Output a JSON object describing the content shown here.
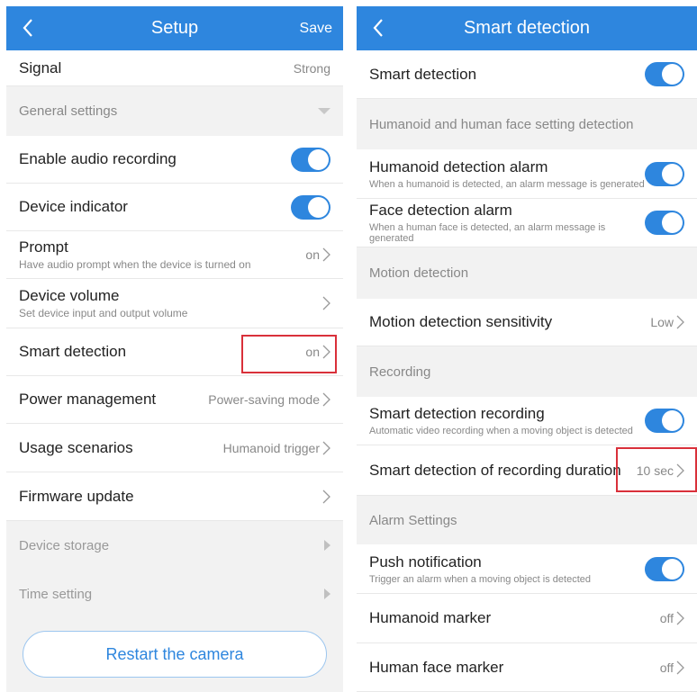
{
  "setup": {
    "title": "Setup",
    "save_label": "Save",
    "signal": {
      "label": "Signal",
      "value": "Strong"
    },
    "general_settings_header": "General settings",
    "enable_audio_recording": {
      "label": "Enable audio recording",
      "enabled": true
    },
    "device_indicator": {
      "label": "Device indicator",
      "enabled": true
    },
    "prompt": {
      "label": "Prompt",
      "desc": "Have audio prompt when the device is turned on",
      "value": "on"
    },
    "device_volume": {
      "label": "Device volume",
      "desc": "Set device input and output volume"
    },
    "smart_detection": {
      "label": "Smart detection",
      "value": "on"
    },
    "power_management": {
      "label": "Power management",
      "value": "Power-saving mode"
    },
    "usage_scenarios": {
      "label": "Usage scenarios",
      "value": "Humanoid trigger"
    },
    "firmware_update": {
      "label": "Firmware update"
    },
    "device_storage": {
      "label": "Device storage"
    },
    "time_setting": {
      "label": "Time setting"
    },
    "restart_label": "Restart the camera"
  },
  "smart": {
    "title": "Smart detection",
    "smart_detection": {
      "label": "Smart detection",
      "enabled": true
    },
    "humanoid_header": "Humanoid and human face setting detection",
    "humanoid_alarm": {
      "label": "Humanoid detection alarm",
      "desc": "When a humanoid is detected, an alarm message is generated",
      "enabled": true
    },
    "face_alarm": {
      "label": "Face detection alarm",
      "desc": "When a human face is detected, an alarm message is generated",
      "enabled": true
    },
    "motion_header": "Motion detection",
    "motion_sensitivity": {
      "label": "Motion detection sensitivity",
      "value": "Low"
    },
    "recording_header": "Recording",
    "smart_recording": {
      "label": "Smart detection recording",
      "desc": "Automatic video recording when a moving object is detected",
      "enabled": true
    },
    "recording_duration": {
      "label": "Smart detection of recording duration",
      "value": "10 sec"
    },
    "alarm_header": "Alarm Settings",
    "push_notification": {
      "label": "Push notification",
      "desc": "Trigger an alarm when a moving object is detected",
      "enabled": true
    },
    "humanoid_marker": {
      "label": "Humanoid marker",
      "value": "off"
    },
    "face_marker": {
      "label": "Human face marker",
      "value": "off"
    }
  },
  "colors": {
    "accent": "#2e86de",
    "highlight": "#d9303a",
    "background": "#f2f2f2"
  }
}
